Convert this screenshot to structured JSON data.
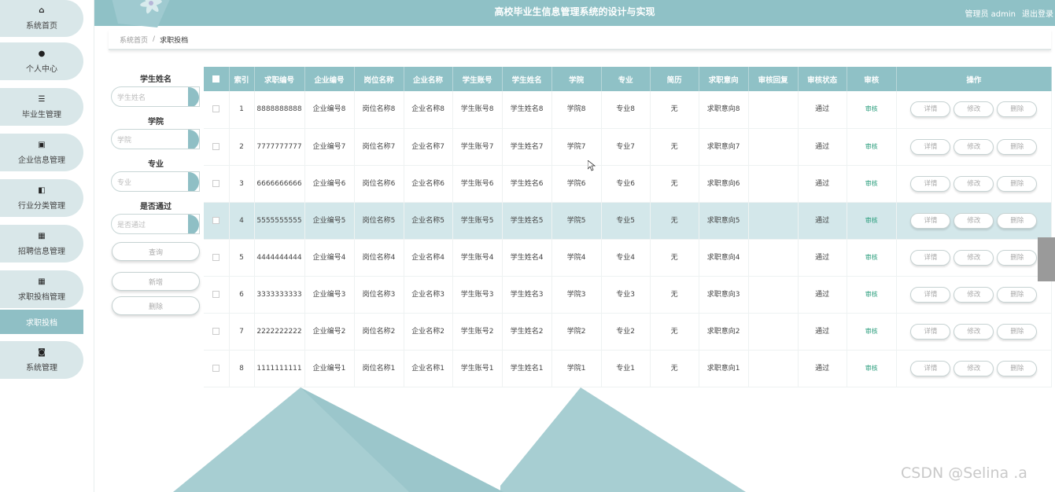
{
  "header": {
    "title": "高校毕业生信息管理系统的设计与实现",
    "user": "管理员 admin",
    "logout": "退出登录"
  },
  "sidebar": {
    "items": [
      {
        "label": "系统首页",
        "icon": "home-icon",
        "glyph": "⌂"
      },
      {
        "label": "个人中心",
        "icon": "person-icon",
        "glyph": "●"
      },
      {
        "label": "毕业生管理",
        "icon": "list-icon",
        "glyph": "☰"
      },
      {
        "label": "企业信息管理",
        "icon": "chart-icon",
        "glyph": "▣"
      },
      {
        "label": "行业分类管理",
        "icon": "briefcase-icon",
        "glyph": "◧"
      },
      {
        "label": "招聘信息管理",
        "icon": "grid-icon",
        "glyph": "▦"
      },
      {
        "label": "求职投档管理",
        "icon": "grid-icon",
        "glyph": "▦"
      },
      {
        "label": "系统管理",
        "icon": "database-icon",
        "glyph": "◙"
      }
    ],
    "active_sub": "求职投档"
  },
  "breadcrumb": {
    "home": "系统首页",
    "separator": "/",
    "current": "求职投档"
  },
  "search": {
    "student_name_label": "学生姓名",
    "student_name_placeholder": "学生姓名",
    "college_label": "学院",
    "college_placeholder": "学院",
    "major_label": "专业",
    "major_placeholder": "专业",
    "passed_label": "是否通过",
    "passed_placeholder": "是否通过",
    "query_button": "查询",
    "add_button": "新增",
    "delete_button": "删除"
  },
  "table": {
    "columns": [
      "索引",
      "求职编号",
      "企业编号",
      "岗位名称",
      "企业名称",
      "学生账号",
      "学生姓名",
      "学院",
      "专业",
      "简历",
      "求职意向",
      "审核回复",
      "审核状态",
      "审核",
      "操作"
    ],
    "audit_label": "审核",
    "detail_label": "详情",
    "edit_label": "修改",
    "delete_label": "删除",
    "rows": [
      {
        "idx": "1",
        "job_no": "8888888888",
        "company_no": "企业编号8",
        "post": "岗位名称8",
        "company": "企业名称8",
        "account": "学生账号8",
        "name": "学生姓名8",
        "college": "学院8",
        "major": "专业8",
        "resume": "无",
        "intent": "求职意向8",
        "reply": "",
        "status": "通过"
      },
      {
        "idx": "2",
        "job_no": "7777777777",
        "company_no": "企业编号7",
        "post": "岗位名称7",
        "company": "企业名称7",
        "account": "学生账号7",
        "name": "学生姓名7",
        "college": "学院7",
        "major": "专业7",
        "resume": "无",
        "intent": "求职意向7",
        "reply": "",
        "status": "通过"
      },
      {
        "idx": "3",
        "job_no": "6666666666",
        "company_no": "企业编号6",
        "post": "岗位名称6",
        "company": "企业名称6",
        "account": "学生账号6",
        "name": "学生姓名6",
        "college": "学院6",
        "major": "专业6",
        "resume": "无",
        "intent": "求职意向6",
        "reply": "",
        "status": "通过"
      },
      {
        "idx": "4",
        "job_no": "5555555555",
        "company_no": "企业编号5",
        "post": "岗位名称5",
        "company": "企业名称5",
        "account": "学生账号5",
        "name": "学生姓名5",
        "college": "学院5",
        "major": "专业5",
        "resume": "无",
        "intent": "求职意向5",
        "reply": "",
        "status": "通过"
      },
      {
        "idx": "5",
        "job_no": "4444444444",
        "company_no": "企业编号4",
        "post": "岗位名称4",
        "company": "企业名称4",
        "account": "学生账号4",
        "name": "学生姓名4",
        "college": "学院4",
        "major": "专业4",
        "resume": "无",
        "intent": "求职意向4",
        "reply": "",
        "status": "通过"
      },
      {
        "idx": "6",
        "job_no": "3333333333",
        "company_no": "企业编号3",
        "post": "岗位名称3",
        "company": "企业名称3",
        "account": "学生账号3",
        "name": "学生姓名3",
        "college": "学院3",
        "major": "专业3",
        "resume": "无",
        "intent": "求职意向3",
        "reply": "",
        "status": "通过"
      },
      {
        "idx": "7",
        "job_no": "2222222222",
        "company_no": "企业编号2",
        "post": "岗位名称2",
        "company": "企业名称2",
        "account": "学生账号2",
        "name": "学生姓名2",
        "college": "学院2",
        "major": "专业2",
        "resume": "无",
        "intent": "求职意向2",
        "reply": "",
        "status": "通过"
      },
      {
        "idx": "8",
        "job_no": "1111111111",
        "company_no": "企业编号1",
        "post": "岗位名称1",
        "company": "企业名称1",
        "account": "学生账号1",
        "name": "学生姓名1",
        "college": "学院1",
        "major": "专业1",
        "resume": "无",
        "intent": "求职意向1",
        "reply": "",
        "status": "通过"
      }
    ]
  },
  "watermark": "CSDN @Selina .a",
  "colors": {
    "accent": "#8fc1c6",
    "sidebar_item": "#d9e7e9",
    "highlight_row": "#d3e7ea",
    "audit_link": "#2a9d7c",
    "background_shape": "#9cc8cc"
  }
}
